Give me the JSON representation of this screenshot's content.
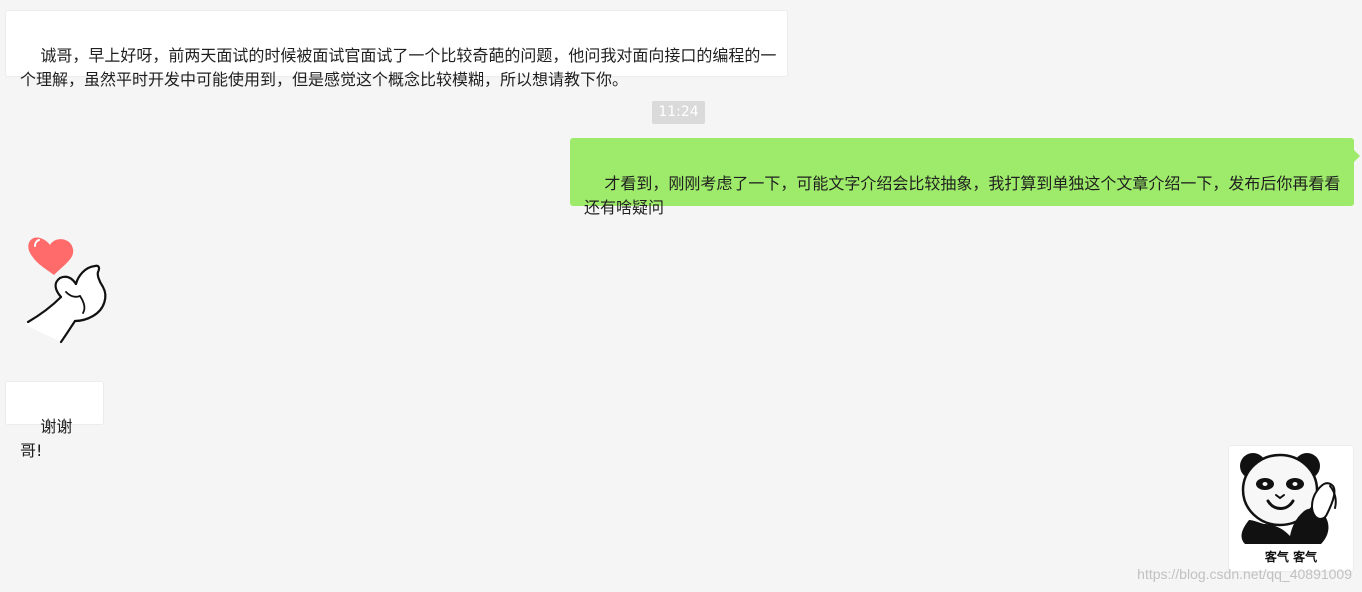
{
  "messages": {
    "m1": "诚哥，早上好呀，前两天面试的时候被面试官面试了一个比较奇葩的问题，他问我对面向接口的编程的一个理解，虽然平时开发中可能使用到，但是感觉这个概念比较模糊，所以想请教下你。",
    "time": "11:24",
    "m2": "才看到，刚刚考虑了一下，可能文字介绍会比较抽象，我打算到单独这个文章介绍一下，发布后你再看看还有啥疑问",
    "m4": "谢谢哥!"
  },
  "stickers": {
    "panda_caption": "客气 客气",
    "heart_icon": "heart-hand-icon",
    "panda_icon": "panda-meme-icon"
  },
  "watermark": "https://blog.csdn.net/qq_40891009",
  "colors": {
    "background": "#f5f5f5",
    "incoming_bubble": "#ffffff",
    "outgoing_bubble": "#9eea6a",
    "time_chip": "#dadada"
  }
}
